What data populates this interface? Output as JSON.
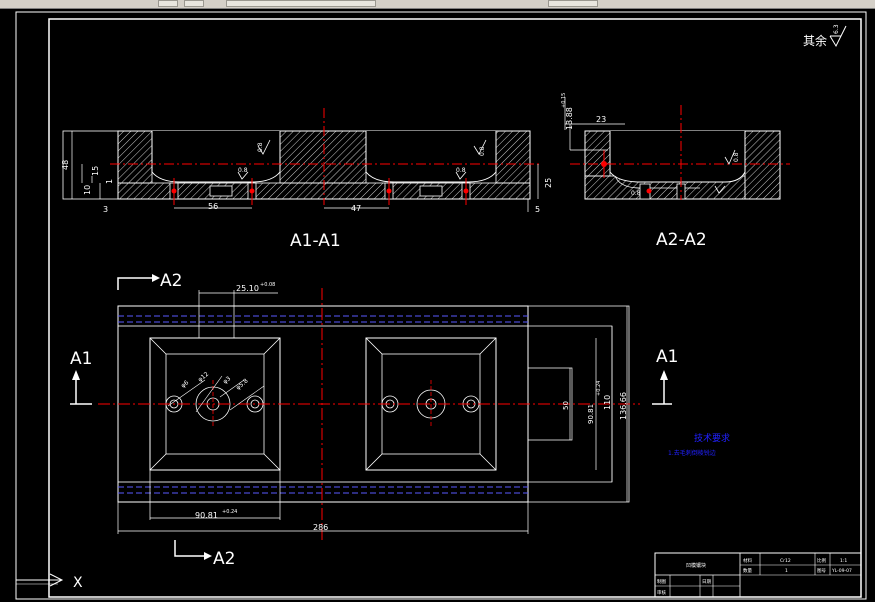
{
  "surface_roughness_other": "其余",
  "surface_roughness_other_value": "6.3",
  "sections": {
    "a1_title": "A1-A1",
    "a2_title": "A2-A2",
    "a1_marker": "A1",
    "a2_marker": "A2",
    "ucs_x": "X"
  },
  "dims_a1": {
    "d48": "48",
    "d15": "15",
    "d1": "1",
    "d10": "10",
    "d3": "3",
    "d56": "56",
    "d47": "47",
    "d25": "25",
    "d5": "5",
    "r_ra1": "0.8",
    "r_ra2": "0.8",
    "r_ra3": "0.8",
    "r_ra4": "0.8"
  },
  "dims_a2": {
    "d23": "23",
    "d13_88": "13.88",
    "d13_tol": "+0.15",
    "r_ra": "0.8",
    "r_ra2": "0.8"
  },
  "dims_plan": {
    "d25_10": "25.10",
    "d25_10_tol": "+0.08",
    "d286": "286",
    "d90_81_bottom": "90.81",
    "d90_81_bottom_tol": "+0.24",
    "d90_81_side": "90.81",
    "d90_81_side_tol": "+0.24",
    "d50": "50",
    "d110": "110",
    "d136_66": "136.66",
    "phi1": "φ6",
    "phi2": "φ12",
    "phi3": "φ3",
    "phi4": "φ5.8"
  },
  "tech_requirements": {
    "title": "技术要求",
    "line1": "1.去毛刺倒棱锐边"
  },
  "title_block": {
    "part_name": "凹模镶块",
    "material_label": "材料",
    "material_value": "Cr12",
    "qty_label": "数量",
    "qty_value": "1",
    "scale_label": "比例",
    "scale_value": "1:1",
    "drawing_no_label": "图号",
    "drawing_no_value": "YL-09-07",
    "designer_label": "制图",
    "checker_label": "审核",
    "date_label": "日期"
  },
  "colors": {
    "background": "#000000",
    "line": "#ffffff",
    "centerline": "#ff0000",
    "hidden": "#5a5aff",
    "hatch": "#ffffff",
    "text": "#ffffff",
    "tech_text": "#2020ff"
  }
}
